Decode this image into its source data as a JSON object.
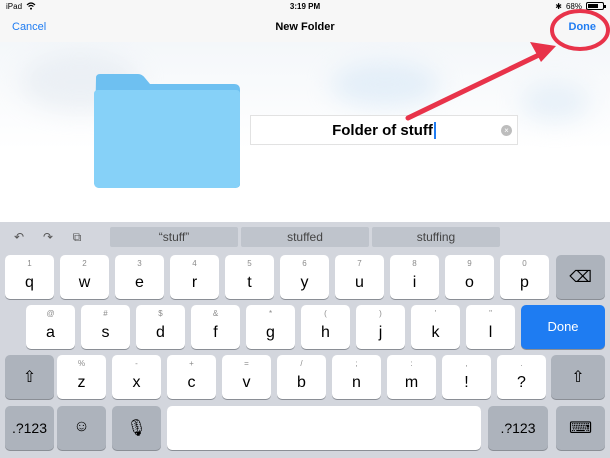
{
  "status_bar": {
    "device": "iPad",
    "time": "3:19 PM",
    "bluetooth": "✱",
    "battery_text": "68%",
    "battery_level": 0.68
  },
  "nav": {
    "cancel_label": "Cancel",
    "title": "New Folder",
    "done_label": "Done"
  },
  "folder_field": {
    "value": "Folder of stuff",
    "clear_icon": "×"
  },
  "keyboard": {
    "tools": {
      "undo": "↶",
      "redo": "↷",
      "paste": "⧉"
    },
    "suggestions": [
      "“stuff”",
      "stuffed",
      "stuffing"
    ],
    "row1": [
      {
        "main": "q",
        "sub": "1"
      },
      {
        "main": "w",
        "sub": "2"
      },
      {
        "main": "e",
        "sub": "3"
      },
      {
        "main": "r",
        "sub": "4"
      },
      {
        "main": "t",
        "sub": "5"
      },
      {
        "main": "y",
        "sub": "6"
      },
      {
        "main": "u",
        "sub": "7"
      },
      {
        "main": "i",
        "sub": "8"
      },
      {
        "main": "o",
        "sub": "9"
      },
      {
        "main": "p",
        "sub": "0"
      }
    ],
    "row2": [
      {
        "main": "a",
        "sub": "@"
      },
      {
        "main": "s",
        "sub": "#"
      },
      {
        "main": "d",
        "sub": "$"
      },
      {
        "main": "f",
        "sub": "&"
      },
      {
        "main": "g",
        "sub": "*"
      },
      {
        "main": "h",
        "sub": "("
      },
      {
        "main": "j",
        "sub": ")"
      },
      {
        "main": "k",
        "sub": "'"
      },
      {
        "main": "l",
        "sub": "\""
      }
    ],
    "row3": [
      {
        "main": "z",
        "sub": "%"
      },
      {
        "main": "x",
        "sub": "-"
      },
      {
        "main": "c",
        "sub": "+"
      },
      {
        "main": "v",
        "sub": "="
      },
      {
        "main": "b",
        "sub": "/"
      },
      {
        "main": "n",
        "sub": ";"
      },
      {
        "main": "m",
        "sub": ":"
      },
      {
        "main": "!",
        "sub": ","
      },
      {
        "main": "?",
        "sub": "."
      }
    ],
    "delete_icon": "⌫",
    "done_label": "Done",
    "shift_icon": "⇧",
    "numbers_label": ".?123",
    "emoji_icon": "☺",
    "mic_icon": "🎙",
    "dismiss_icon": "⌨"
  },
  "colors": {
    "accent": "#1f7cf2",
    "annotation": "#e8334a",
    "folder": "#7ccbf5"
  }
}
